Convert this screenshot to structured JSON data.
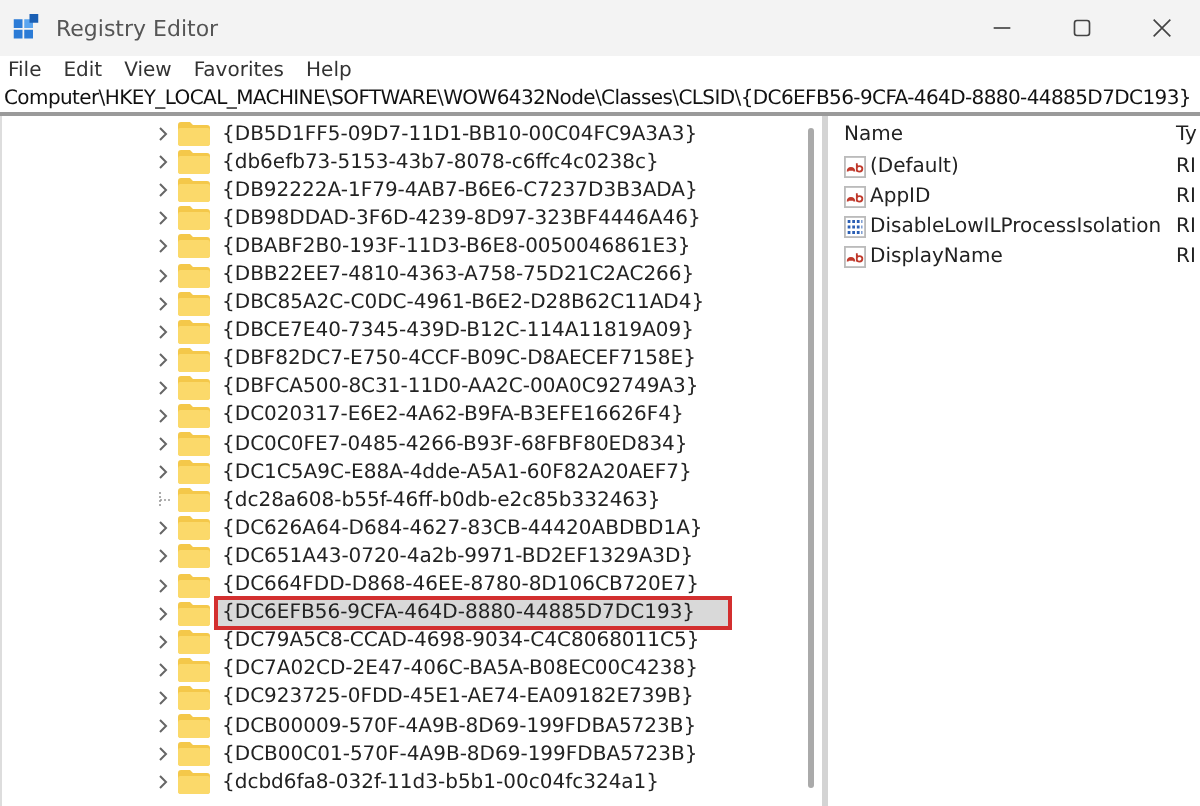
{
  "window": {
    "title": "Registry Editor"
  },
  "menu": [
    "File",
    "Edit",
    "View",
    "Favorites",
    "Help"
  ],
  "address": "Computer\\HKEY_LOCAL_MACHINE\\SOFTWARE\\WOW6432Node\\Classes\\CLSID\\{DC6EFB56-9CFA-464D-8880-44885D7DC193}",
  "tree": [
    {
      "label": "{DB5D1FF5-09D7-11D1-BB10-00C04FC9A3A3}",
      "expandable": true,
      "selected": false,
      "highlighted": false
    },
    {
      "label": "{db6efb73-5153-43b7-8078-c6ffc4c0238c}",
      "expandable": true,
      "selected": false,
      "highlighted": false
    },
    {
      "label": "{DB92222A-1F79-4AB7-B6E6-C7237D3B3ADA}",
      "expandable": true,
      "selected": false,
      "highlighted": false
    },
    {
      "label": "{DB98DDAD-3F6D-4239-8D97-323BF4446A46}",
      "expandable": true,
      "selected": false,
      "highlighted": false
    },
    {
      "label": "{DBABF2B0-193F-11D3-B6E8-0050046861E3}",
      "expandable": true,
      "selected": false,
      "highlighted": false
    },
    {
      "label": "{DBB22EE7-4810-4363-A758-75D21C2AC266}",
      "expandable": true,
      "selected": false,
      "highlighted": false
    },
    {
      "label": "{DBC85A2C-C0DC-4961-B6E2-D28B62C11AD4}",
      "expandable": true,
      "selected": false,
      "highlighted": false
    },
    {
      "label": "{DBCE7E40-7345-439D-B12C-114A11819A09}",
      "expandable": true,
      "selected": false,
      "highlighted": false
    },
    {
      "label": "{DBF82DC7-E750-4CCF-B09C-D8AECEF7158E}",
      "expandable": true,
      "selected": false,
      "highlighted": false
    },
    {
      "label": "{DBFCA500-8C31-11D0-AA2C-00A0C92749A3}",
      "expandable": true,
      "selected": false,
      "highlighted": false
    },
    {
      "label": "{DC020317-E6E2-4A62-B9FA-B3EFE16626F4}",
      "expandable": true,
      "selected": false,
      "highlighted": false
    },
    {
      "label": "{DC0C0FE7-0485-4266-B93F-68FBF80ED834}",
      "expandable": true,
      "selected": false,
      "highlighted": false
    },
    {
      "label": "{DC1C5A9C-E88A-4dde-A5A1-60F82A20AEF7}",
      "expandable": true,
      "selected": false,
      "highlighted": false
    },
    {
      "label": "{dc28a608-b55f-46ff-b0db-e2c85b332463}",
      "expandable": false,
      "selected": false,
      "highlighted": false
    },
    {
      "label": "{DC626A64-D684-4627-83CB-44420ABDBD1A}",
      "expandable": true,
      "selected": false,
      "highlighted": false
    },
    {
      "label": "{DC651A43-0720-4a2b-9971-BD2EF1329A3D}",
      "expandable": true,
      "selected": false,
      "highlighted": false
    },
    {
      "label": "{DC664FDD-D868-46EE-8780-8D106CB720E7}",
      "expandable": true,
      "selected": false,
      "highlighted": false
    },
    {
      "label": "{DC6EFB56-9CFA-464D-8880-44885D7DC193}",
      "expandable": true,
      "selected": true,
      "highlighted": true
    },
    {
      "label": "{DC79A5C8-CCAD-4698-9034-C4C8068011C5}",
      "expandable": true,
      "selected": false,
      "highlighted": false
    },
    {
      "label": "{DC7A02CD-2E47-406C-BA5A-B08EC00C4238}",
      "expandable": true,
      "selected": false,
      "highlighted": false
    },
    {
      "label": "{DC923725-0FDD-45E1-AE74-EA09182E739B}",
      "expandable": true,
      "selected": false,
      "highlighted": false
    },
    {
      "label": "{DCB00009-570F-4A9B-8D69-199FDBA5723B}",
      "expandable": true,
      "selected": false,
      "highlighted": false
    },
    {
      "label": "{DCB00C01-570F-4A9B-8D69-199FDBA5723B}",
      "expandable": true,
      "selected": false,
      "highlighted": false
    },
    {
      "label": "{dcbd6fa8-032f-11d3-b5b1-00c04fc324a1}",
      "expandable": true,
      "selected": false,
      "highlighted": false
    }
  ],
  "values": {
    "columns": [
      "Name",
      "Ty"
    ],
    "rows": [
      {
        "name": "(Default)",
        "type": "RI",
        "kind": "string"
      },
      {
        "name": "AppID",
        "type": "RI",
        "kind": "string"
      },
      {
        "name": "DisableLowILProcessIsolation",
        "type": "RI",
        "kind": "binary"
      },
      {
        "name": "DisplayName",
        "type": "RI",
        "kind": "string"
      }
    ]
  }
}
